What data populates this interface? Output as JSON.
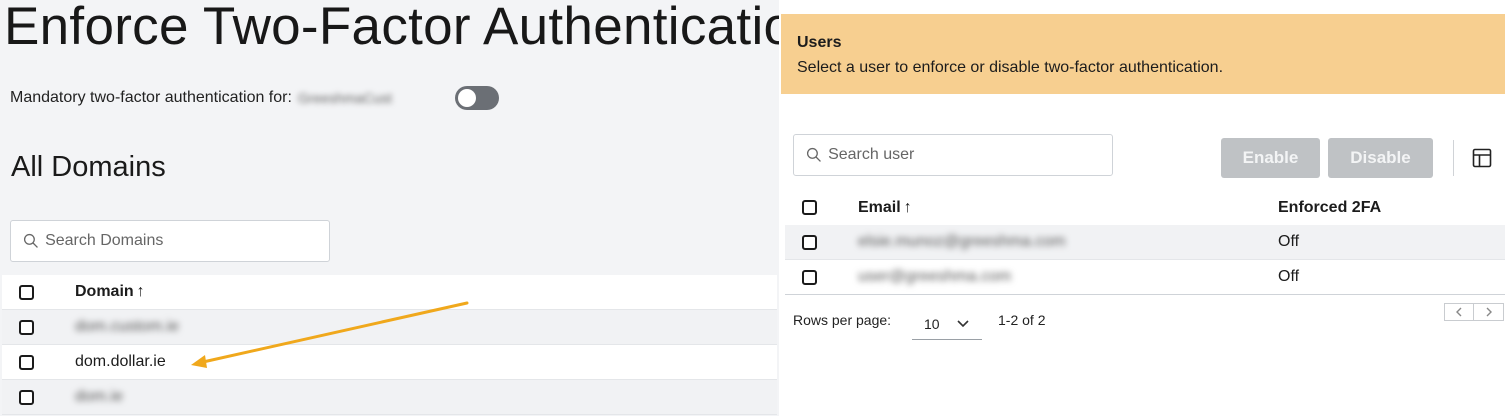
{
  "left_panel": {
    "page_title": "Enforce Two-Factor Authenticatio",
    "mandatory_label": "Mandatory two-factor authentication for:",
    "mandatory_org": "GreeshmaCust",
    "toggle_state": "off",
    "section_title": "All Domains",
    "search": {
      "placeholder": "Search Domains"
    },
    "table": {
      "header": {
        "domain": "Domain",
        "sort_icon": "arrow-up-icon"
      },
      "rows": [
        {
          "domain": "dom.custom.ie",
          "blurred": true
        },
        {
          "domain": "dom.dollar.ie",
          "blurred": false
        },
        {
          "domain": "dom.ie",
          "blurred": true
        }
      ]
    },
    "annotation_color": "#f0a81c"
  },
  "right_panel": {
    "banner": {
      "title": "Users",
      "subtitle": "Select a user to enforce or disable two-factor authentication.",
      "background": "#f7cf90"
    },
    "search": {
      "placeholder": "Search user"
    },
    "buttons": {
      "enable": "Enable",
      "disable": "Disable"
    },
    "table": {
      "header": {
        "email": "Email",
        "enforced": "Enforced 2FA",
        "sort_icon": "arrow-up-icon"
      },
      "rows": [
        {
          "email": "elsie.munoz@greeshma.com",
          "enforced": "Off"
        },
        {
          "email": "user@greeshma.com",
          "enforced": "Off"
        }
      ]
    },
    "pagination": {
      "rows_per_page_label": "Rows per page:",
      "rows_per_page_value": "10",
      "range_text": "1-2 of 2"
    }
  }
}
